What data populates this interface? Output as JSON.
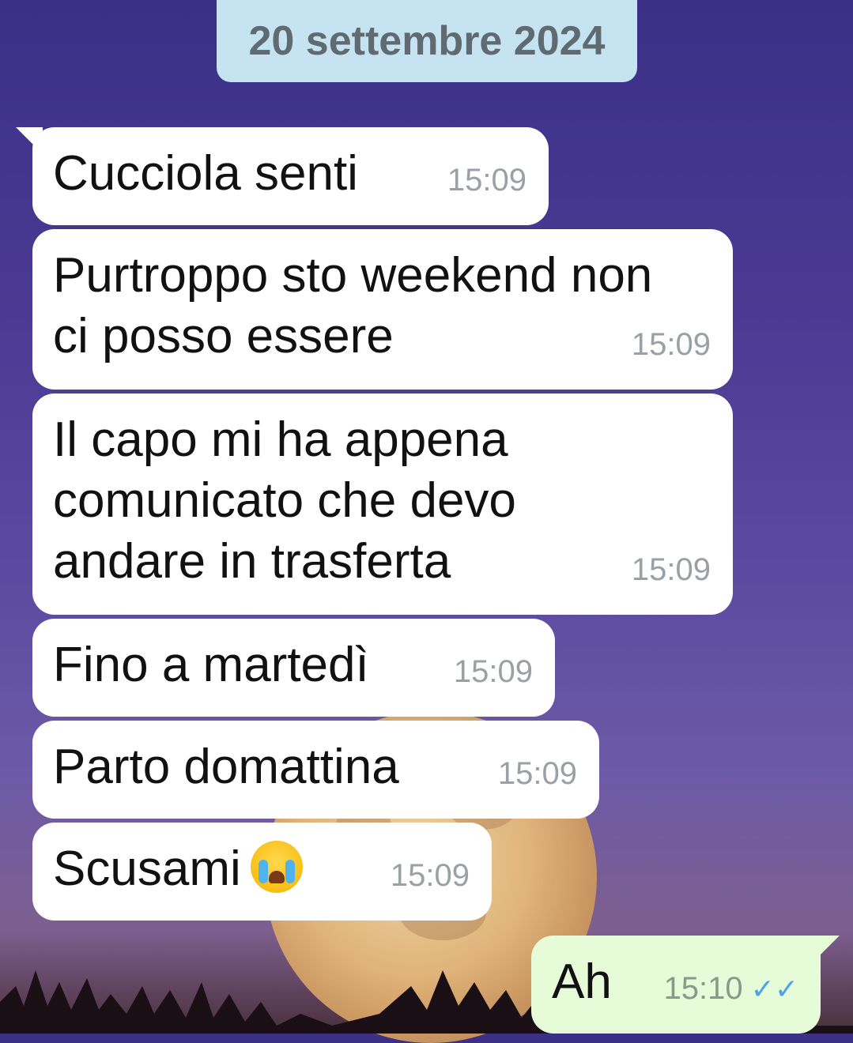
{
  "date_separator": "20 settembre 2024",
  "messages": [
    {
      "direction": "incoming",
      "text": "Cucciola senti",
      "time": "15:09"
    },
    {
      "direction": "incoming",
      "text": "Purtroppo sto weekend non\nci posso essere",
      "time": "15:09"
    },
    {
      "direction": "incoming",
      "text": "Il capo mi ha appena\ncomunicato che devo\nandare in trasferta",
      "time": "15:09"
    },
    {
      "direction": "incoming",
      "text": "Fino a martedì",
      "time": "15:09"
    },
    {
      "direction": "incoming",
      "text": "Parto domattina",
      "time": "15:09"
    },
    {
      "direction": "incoming",
      "text": "Scusami",
      "emoji": "loudly-crying-face-emoji",
      "time": "15:09"
    },
    {
      "direction": "outgoing",
      "text": "Ah",
      "time": "15:10",
      "status_icon": "double-check-read-icon",
      "status_color": "#4da3e6"
    }
  ],
  "colors": {
    "incoming_bubble": "#ffffff",
    "outgoing_bubble": "#e6fbd8",
    "date_chip": "#c5e3f0"
  }
}
